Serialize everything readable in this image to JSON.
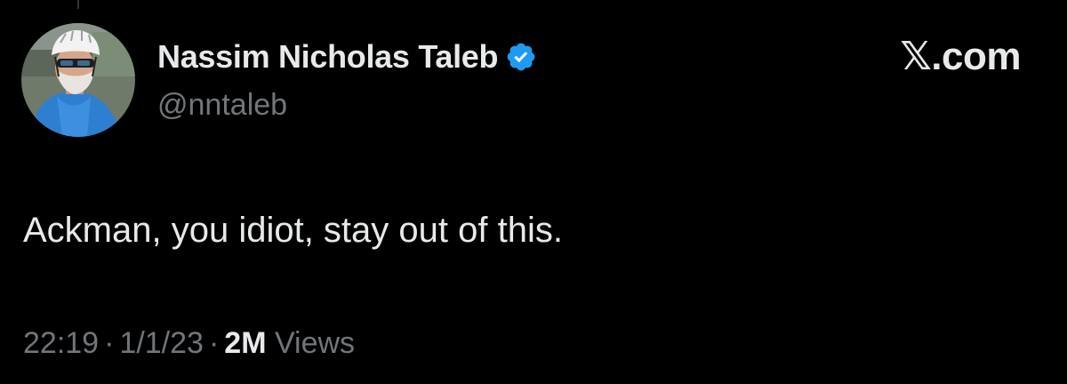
{
  "author": {
    "display_name": "Nassim Nicholas Taleb",
    "handle": "@nntaleb",
    "verified": true,
    "verified_icon": "verified-badge-icon",
    "verified_color": "#1d9bf0"
  },
  "brand": {
    "label": "𝕏.com"
  },
  "tweet": {
    "text": "Ackman, you idiot, stay out of this.",
    "time": "22:19",
    "date": "1/1/23",
    "separator": "·",
    "views_count": "2M",
    "views_label": "Views"
  },
  "colors": {
    "background": "#000000",
    "primary_text": "#e7e9ea",
    "secondary_text": "#71767b"
  }
}
